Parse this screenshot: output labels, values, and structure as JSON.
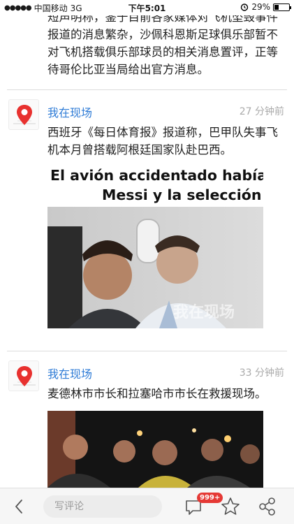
{
  "status_bar": {
    "signal": "●●●●●",
    "carrier": "中国移动",
    "network": "3G",
    "time": "下午5:01",
    "battery_percent": "29%",
    "battery_level": 0.29
  },
  "continued_text": "短声明称，鉴于目前各家媒体对飞机坠毁事件报道的消息繁杂，沙佩科恩斯足球俱乐部暂不对飞机搭载俱乐部球员的相关消息置评，正等待哥伦比亚当局给出官方消息。",
  "posts": [
    {
      "author": "我在现场",
      "time": "27 分钟前",
      "text": "西班牙《每日体育报》报道称，巴甲队失事飞机本月曾搭载阿根廷国家队赴巴西。",
      "image_caption": "El avión accidentado había\nMessi y la selección",
      "watermark": "我在现场"
    },
    {
      "author": "我在现场",
      "time": "33 分钟前",
      "text": "麦德林市市长和拉塞哈市市长在救援现场。"
    }
  ],
  "bottom_bar": {
    "comment_placeholder": "写评论",
    "comment_count": "999+"
  },
  "colors": {
    "author_blue": "#2e7bd6",
    "badge_red": "#e53935",
    "pin_red": "#e8312f"
  },
  "icons": [
    "back-icon",
    "comment-icon",
    "star-icon",
    "share-icon",
    "location-pin-icon"
  ]
}
